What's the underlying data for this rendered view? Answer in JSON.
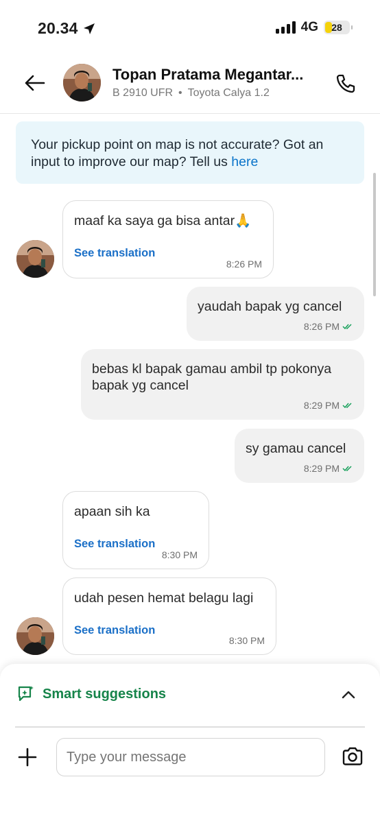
{
  "status_bar": {
    "time": "20.34",
    "network": "4G",
    "battery": "28",
    "battery_level": 0.28
  },
  "header": {
    "driver_name": "Topan Pratama Megantar...",
    "plate": "B 2910 UFR",
    "separator": "•",
    "vehicle": "Toyota Calya 1.2"
  },
  "banner": {
    "text": "Your pickup point on map is not accurate? Got an input to improve our map? Tell us ",
    "link": "here"
  },
  "messages": [
    {
      "direction": "incoming",
      "text": "maaf ka saya ga bisa antar🙏",
      "translation_label": "See translation",
      "time": "8:26 PM"
    },
    {
      "direction": "outgoing",
      "text": "yaudah bapak yg cancel",
      "time": "8:26 PM",
      "read": true
    },
    {
      "direction": "outgoing",
      "text": "bebas kl bapak gamau ambil tp pokonya bapak yg cancel",
      "time": "8:29 PM",
      "read": true
    },
    {
      "direction": "outgoing",
      "text": "sy gamau cancel",
      "time": "8:29 PM",
      "read": true
    },
    {
      "direction": "incoming",
      "text": "apaan sih ka",
      "translation_label": "See translation",
      "time": "8:30 PM"
    },
    {
      "direction": "incoming",
      "text": "udah pesen hemat belagu lagi",
      "translation_label": "See translation",
      "time": "8:30 PM"
    }
  ],
  "composer": {
    "smart_suggestions_label": "Smart suggestions",
    "input_value": "",
    "input_placeholder": "Type your message"
  },
  "colors": {
    "accent_green": "#16844a",
    "link_blue": "#1a6fc7",
    "banner_bg": "#e9f6fb",
    "read_tick": "#16a05a"
  },
  "icons": [
    "location-arrow-icon",
    "signal-icon",
    "back-arrow-icon",
    "phone-icon",
    "double-check-icon",
    "smart-suggestion-icon",
    "chevron-up-icon",
    "plus-icon",
    "camera-icon"
  ]
}
